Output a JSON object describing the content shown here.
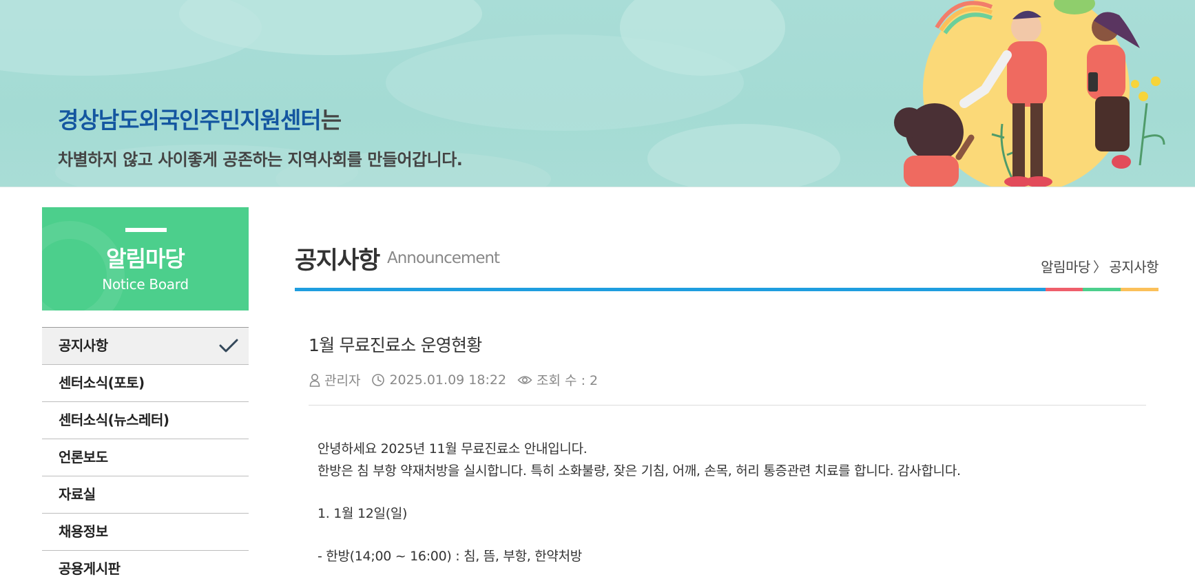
{
  "banner": {
    "org_name": "경상남도외국인주민지원센터",
    "org_suffix": "는",
    "tagline": "차별하지 않고 사이좋게 공존하는 지역사회를 만들어갑니다."
  },
  "sidebar": {
    "title": "알림마당",
    "subtitle": "Notice Board",
    "items": [
      {
        "label": "공지사항",
        "active": true
      },
      {
        "label": "센터소식(포토)"
      },
      {
        "label": "센터소식(뉴스레터)"
      },
      {
        "label": "언론보도"
      },
      {
        "label": "자료실"
      },
      {
        "label": "채용정보"
      },
      {
        "label": "공용게시판"
      }
    ]
  },
  "page": {
    "title": "공지사항",
    "title_en": "Announcement",
    "breadcrumb": [
      "알림마당",
      "공지사항"
    ],
    "breadcrumb_sep": "〉"
  },
  "post": {
    "title": "1월 무료진료소 운영현황",
    "author": "관리자",
    "date": "2025.01.09 18:22",
    "views_label": "조회 수 : 2",
    "body": [
      "안녕하세요 2025년 11월 무료진료소 안내입니다.",
      "한방은 침 부항 약재처방을 실시합니다. 특히 소화불량, 잦은 기침, 어깨, 손목, 허리 통증관련 치료를 합니다. 감사합니다.",
      "",
      "1. 1월 12일(일)",
      "",
      "- 한방(14;00 ~ 16:00) : 침, 뜸, 부항, 한약처방"
    ]
  },
  "colors": {
    "banner_bg": "#a9ddd7",
    "brand_blue": "#1456a0",
    "sidebar_green": "#4ccf8c",
    "title_bar_blue": "#1f9ddf",
    "accent_red": "#ef5f6b",
    "accent_green": "#4ccf8c",
    "accent_yellow": "#fbc05a"
  },
  "icons": [
    "check-icon",
    "user-icon",
    "clock-icon",
    "eye-icon"
  ]
}
